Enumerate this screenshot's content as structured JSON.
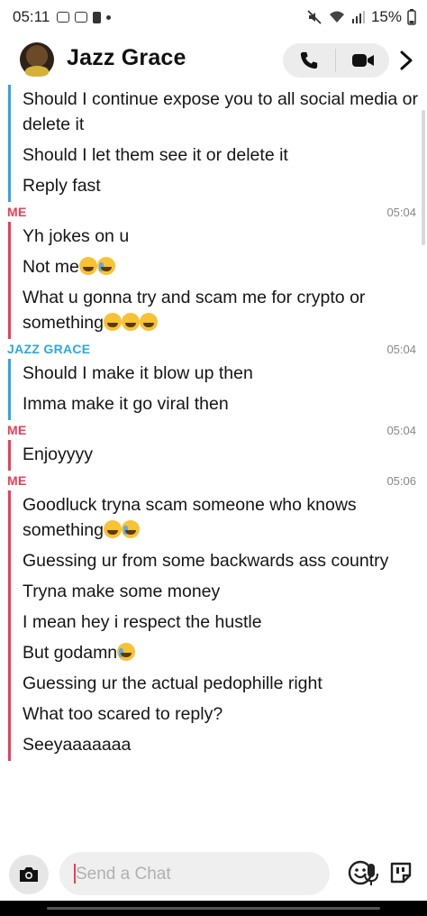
{
  "status_bar": {
    "time": "05:11",
    "battery": "15%"
  },
  "header": {
    "title": "Jazz Grace"
  },
  "messages": [
    {
      "sender": "",
      "time": "",
      "side": "them",
      "lines": [
        "Should I continue expose you to all social media or delete it",
        "Should I let them see it or delete it",
        "Reply fast"
      ]
    },
    {
      "sender": "ME",
      "time": "05:04",
      "side": "me",
      "lines": [
        "Yh jokes on u",
        "Not me",
        "What u gonna try and scam me for crypto or something"
      ]
    },
    {
      "sender": "JAZZ GRACE",
      "time": "05:04",
      "side": "them",
      "lines": [
        "Should I make it blow up then",
        "Imma make it go viral then"
      ]
    },
    {
      "sender": "ME",
      "time": "05:04",
      "side": "me",
      "lines": [
        "Enjoyyyy"
      ]
    },
    {
      "sender": "ME",
      "time": "05:06",
      "side": "me",
      "lines": [
        "Goodluck tryna scam someone who knows something",
        "Guessing ur from some backwards ass country",
        "Tryna make some money",
        "I mean hey i respect the hustle",
        "But godamn",
        "Guessing ur the actual pedophille right",
        "What too scared to reply?",
        "Seeyaaaaaaa"
      ]
    }
  ],
  "composer": {
    "placeholder": "Send a Chat"
  },
  "colors": {
    "me": "#f23c57",
    "them": "#2ea8e0"
  },
  "icons": [
    "camera-icon",
    "microphone-icon",
    "smiley-icon",
    "sticker-icon",
    "phone-icon",
    "video-icon",
    "chevron-right-icon"
  ]
}
